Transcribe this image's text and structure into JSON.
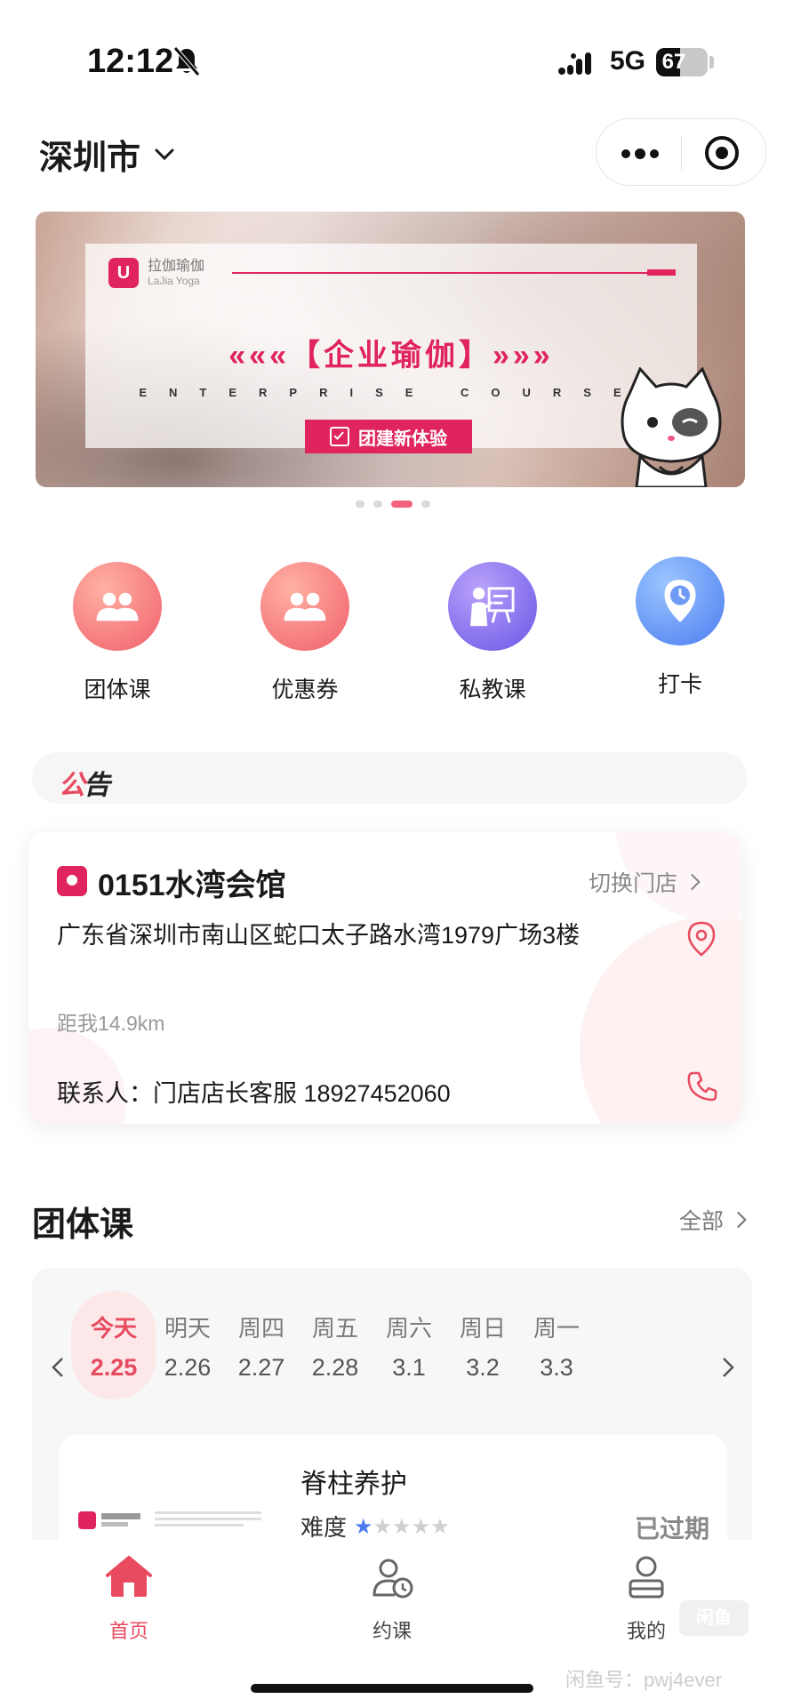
{
  "status_bar": {
    "time": "12:12",
    "network": "5G",
    "battery_level": 67,
    "battery_text": "67"
  },
  "header": {
    "city": "深圳市",
    "icons": [
      "chevron-down-icon",
      "more-icon",
      "close-target-icon"
    ]
  },
  "banner": {
    "logo_mark": "U",
    "logo_text": "拉伽瑜伽",
    "logo_sub": "LaJia Yoga",
    "title": "«««【企业瑜伽】»»»",
    "subtitle": "ENTERPRISE COURSE",
    "button_label": "团建新体验",
    "dot_count": 4,
    "active_dot": 2
  },
  "quick_actions": [
    {
      "label": "团体课",
      "icon": "group-icon",
      "color_from": "#ff9a8e",
      "color_to": "#f05f6a"
    },
    {
      "label": "优惠券",
      "icon": "group-icon",
      "color_from": "#ff9a8e",
      "color_to": "#f05f6a"
    },
    {
      "label": "私教课",
      "icon": "teacher-icon",
      "color_from": "#a487f5",
      "color_to": "#6a55e6"
    },
    {
      "label": "打卡",
      "icon": "clock-pin-icon",
      "color_from": "#7fb3ff",
      "color_to": "#4a7cf0"
    }
  ],
  "notice": {
    "tag_accent": "公",
    "tag_rest": "告"
  },
  "store": {
    "name": "0151水湾会馆",
    "switch_label": "切换门店",
    "address": "广东省深圳市南山区蛇口太子路水湾1979广场3楼",
    "distance": "距我14.9km",
    "contact": "联系人：门店店长客服 18927452060"
  },
  "group_class": {
    "title": "团体课",
    "all_label": "全部",
    "dates": [
      {
        "day": "今天",
        "date": "2.25",
        "active": true
      },
      {
        "day": "明天",
        "date": "2.26",
        "active": false
      },
      {
        "day": "周四",
        "date": "2.27",
        "active": false
      },
      {
        "day": "周五",
        "date": "2.28",
        "active": false
      },
      {
        "day": "周六",
        "date": "3.1",
        "active": false
      },
      {
        "day": "周日",
        "date": "3.2",
        "active": false
      },
      {
        "day": "周一",
        "date": "3.3",
        "active": false
      }
    ],
    "class": {
      "title": "脊柱养护",
      "difficulty_label": "难度",
      "difficulty_rating": 1,
      "difficulty_max": 5,
      "status": "已过期"
    }
  },
  "tab_bar": {
    "tabs": [
      {
        "label": "首页",
        "icon": "home-icon",
        "active": true
      },
      {
        "label": "约课",
        "icon": "booking-icon",
        "active": false
      },
      {
        "label": "我的",
        "icon": "profile-icon",
        "active": false
      }
    ]
  },
  "watermark": {
    "box_text": "闲鱼",
    "text": "闲鱼号：pwj4ever"
  },
  "colors": {
    "accent": "#e84a5f",
    "brand": "#e0245e",
    "star": "#4a7cf0"
  }
}
